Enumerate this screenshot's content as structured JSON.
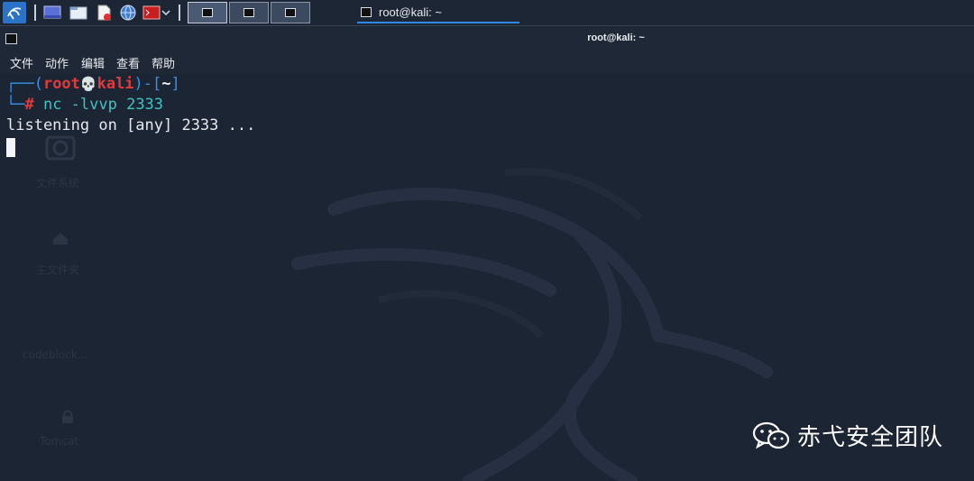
{
  "taskbar": {
    "task_label": "root@kali: ~"
  },
  "window": {
    "title": "root@kali: ~"
  },
  "menu": {
    "items": [
      "文件",
      "动作",
      "编辑",
      "查看",
      "帮助"
    ]
  },
  "terminal": {
    "prompt_open": "┌──(",
    "user": "root",
    "skull": "💀",
    "host": "kali",
    "prompt_mid": ")-[",
    "cwd": "~",
    "prompt_close": "]",
    "prompt_corner": "└─",
    "hash": "#",
    "command": " nc -lvvp 2333",
    "output": "listening on [any] 2333 ..."
  },
  "desktop_ghost": {
    "items": [
      "文件系统",
      "主文件夹",
      "codeblock...",
      "Tomcat"
    ]
  },
  "watermark": {
    "text": "赤弋安全团队"
  },
  "colors": {
    "background": "#1c2533",
    "prompt_blue": "#3b8ee6",
    "prompt_red": "#e23a3a",
    "command_cyan": "#3ec2c2"
  }
}
